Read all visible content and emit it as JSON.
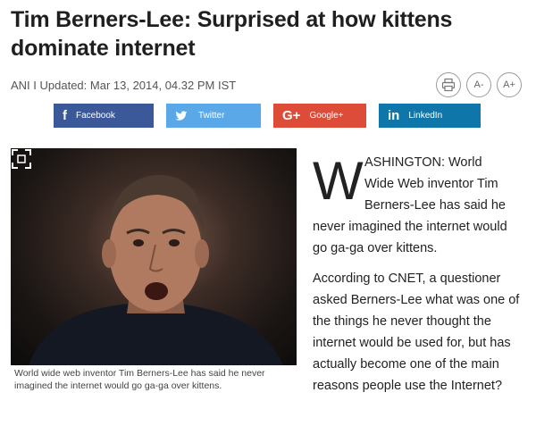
{
  "headline": "Tim Berners-Lee: Surprised at how kittens dominate internet",
  "meta": "ANI I Updated: Mar 13, 2014, 04.32 PM IST",
  "tools": {
    "decrease_font": "A-",
    "increase_font": "A+"
  },
  "share": {
    "facebook": "Facebook",
    "twitter": "Twitter",
    "google": "Google+",
    "linkedin": "LinkedIn",
    "facebook_glyph": "f",
    "google_glyph": "G+",
    "linkedin_glyph": "in"
  },
  "caption": "World wide web inventor Tim Berners-Lee has said he never imagined the internet would go ga-ga over kittens.",
  "article": {
    "dropcap": "W",
    "p1_lines": [
      "ASHINGTON: World",
      "Wide Web inventor Tim",
      "Berners-Lee has said he",
      "never imagined the internet would",
      "go ga-ga over kittens."
    ],
    "p2": "According to CNET, a questioner asked Berners-Lee what was one of the things he never thought the internet would be used for, but has actually become one of the main reasons people use the Internet?"
  },
  "colors": {
    "facebook": "#3b5998",
    "twitter": "#5aa8e8",
    "google": "#dd4b39",
    "linkedin": "#0e76a8"
  }
}
